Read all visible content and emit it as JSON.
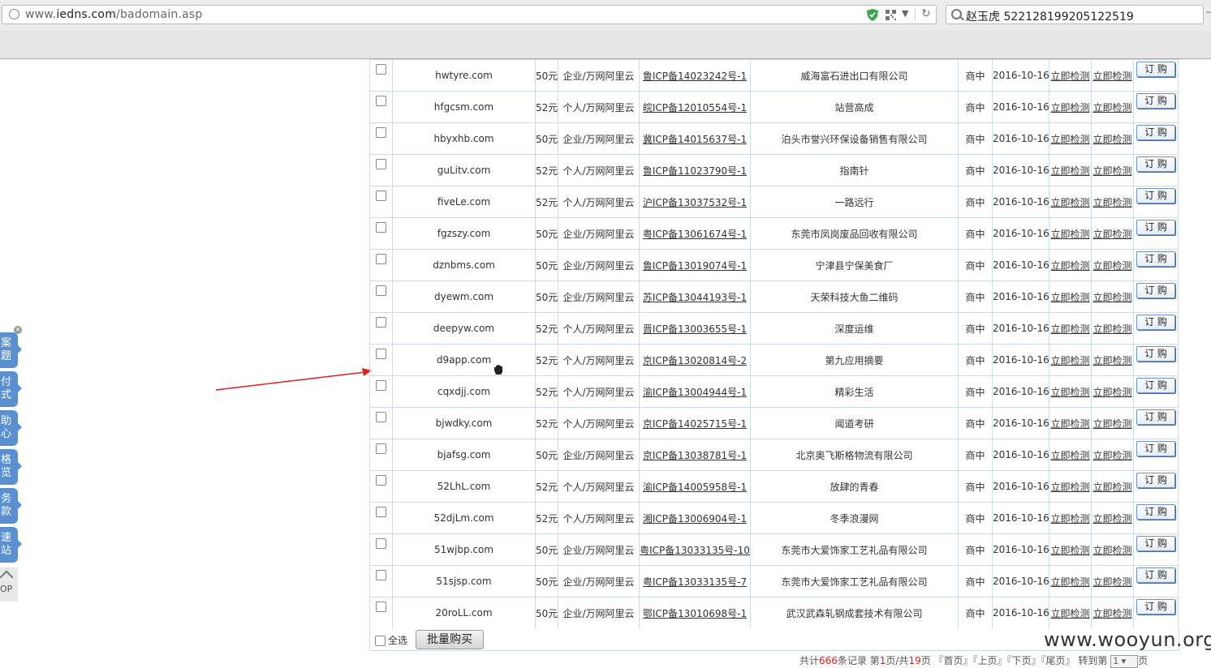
{
  "browser": {
    "url_prefix": "www.",
    "url_domain": "iedns.com",
    "url_path": "/badomain.asp",
    "search_text": "赵玉虎 522128199205122519"
  },
  "side_tabs": [
    "案\n题",
    "付\n式",
    "助\n心",
    "格\n览",
    "务\n款",
    "速\n站"
  ],
  "side_top_label": "OP",
  "rows": [
    {
      "domain": "hwtyre.com",
      "price": "50元",
      "type": "企业/万网阿里云",
      "icp": "鲁ICP备14023242号-1",
      "org": "威海富石进出口有限公司",
      "status": "商中",
      "date": "2016-10-16"
    },
    {
      "domain": "hfgcsm.com",
      "price": "52元",
      "type": "个人/万网阿里云",
      "icp": "皖ICP备12010554号-1",
      "org": "站营高成",
      "status": "商中",
      "date": "2016-10-16"
    },
    {
      "domain": "hbyxhb.com",
      "price": "50元",
      "type": "企业/万网阿里云",
      "icp": "冀ICP备14015637号-1",
      "org": "泊头市誉兴环保设备销售有限公司",
      "status": "商中",
      "date": "2016-10-16"
    },
    {
      "domain": "guLitv.com",
      "price": "52元",
      "type": "个人/万网阿里云",
      "icp": "鲁ICP备11023790号-1",
      "org": "指南针",
      "status": "商中",
      "date": "2016-10-16"
    },
    {
      "domain": "fiveLe.com",
      "price": "52元",
      "type": "个人/万网阿里云",
      "icp": "沪ICP备13037532号-1",
      "org": "一路远行",
      "status": "商中",
      "date": "2016-10-16"
    },
    {
      "domain": "fgzszy.com",
      "price": "50元",
      "type": "企业/万网阿里云",
      "icp": "粤ICP备13061674号-1",
      "org": "东莞市凤岗废品回收有限公司",
      "status": "商中",
      "date": "2016-10-16"
    },
    {
      "domain": "dznbms.com",
      "price": "50元",
      "type": "企业/万网阿里云",
      "icp": "鲁ICP备13019074号-1",
      "org": "宁津县宁保美食厂",
      "status": "商中",
      "date": "2016-10-16"
    },
    {
      "domain": "dyewm.com",
      "price": "50元",
      "type": "企业/万网阿里云",
      "icp": "苏ICP备13044193号-1",
      "org": "天荣科技大鱼二维码",
      "status": "商中",
      "date": "2016-10-16"
    },
    {
      "domain": "deepyw.com",
      "price": "52元",
      "type": "个人/万网阿里云",
      "icp": "晋ICP备13003655号-1",
      "org": "深度运维",
      "status": "商中",
      "date": "2016-10-16"
    },
    {
      "domain": "d9app.com",
      "price": "52元",
      "type": "个人/万网阿里云",
      "icp": "京ICP备13020814号-2",
      "org": "第九应用摘要",
      "status": "商中",
      "date": "2016-10-16"
    },
    {
      "domain": "cqxdjj.com",
      "price": "52元",
      "type": "个人/万网阿里云",
      "icp": "渝ICP备13004944号-1",
      "org": "精彩生活",
      "status": "商中",
      "date": "2016-10-16"
    },
    {
      "domain": "bjwdky.com",
      "price": "52元",
      "type": "个人/万网阿里云",
      "icp": "京ICP备14025715号-1",
      "org": "闻道考研",
      "status": "商中",
      "date": "2016-10-16"
    },
    {
      "domain": "bjafsg.com",
      "price": "50元",
      "type": "企业/万网阿里云",
      "icp": "京ICP备13038781号-1",
      "org": "北京奥飞斯格物流有限公司",
      "status": "商中",
      "date": "2016-10-16"
    },
    {
      "domain": "52LhL.com",
      "price": "52元",
      "type": "个人/万网阿里云",
      "icp": "渝ICP备14005958号-1",
      "org": "放肆的青春",
      "status": "商中",
      "date": "2016-10-16"
    },
    {
      "domain": "52djLm.com",
      "price": "52元",
      "type": "个人/万网阿里云",
      "icp": "湘ICP备13006904号-1",
      "org": "冬季浪漫网",
      "status": "商中",
      "date": "2016-10-16"
    },
    {
      "domain": "51wjbp.com",
      "price": "50元",
      "type": "企业/万网阿里云",
      "icp": "粤ICP备13033135号-10",
      "org": "东莞市大爱饰家工艺礼品有限公司",
      "status": "商中",
      "date": "2016-10-16"
    },
    {
      "domain": "51sjsp.com",
      "price": "50元",
      "type": "企业/万网阿里云",
      "icp": "粤ICP备13033135号-7",
      "org": "东莞市大爱饰家工艺礼品有限公司",
      "status": "商中",
      "date": "2016-10-16"
    },
    {
      "domain": "20roLL.com",
      "price": "50元",
      "type": "企业/万网阿里云",
      "icp": "鄂ICP备13010698号-1",
      "org": "武汉武森轧钢成套技术有限公司",
      "status": "商中",
      "date": "2016-10-16"
    }
  ],
  "row_links": {
    "check1": "立即检测",
    "check2": "立即检测",
    "order": "订 购"
  },
  "bottom": {
    "select_all": "全选",
    "batch_buy": "批量购买"
  },
  "pager": {
    "prefix": "共计",
    "total": "666",
    "mid1": "条记录 第",
    "current": "1",
    "mid2": "页/共",
    "pages": "19",
    "mid3": "页  『首页』『上页』『下页』『尾页』 转到第",
    "select_value": "1",
    "suffix": "页"
  },
  "watermark": "www.wooyun.org",
  "colors": {
    "accent": "#5a8fd0",
    "arrow": "#e02020",
    "border": "#cfdbe8"
  }
}
